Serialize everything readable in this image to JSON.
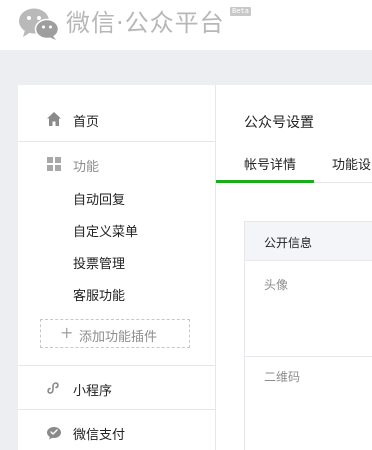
{
  "header": {
    "brand": "微信·公众平台",
    "beta_badge": "Beta"
  },
  "sidebar": {
    "home": "首页",
    "features": {
      "label": "功能",
      "items": [
        "自动回复",
        "自定义菜单",
        "投票管理",
        "客服功能"
      ]
    },
    "add_plugin": "添加功能插件",
    "mini_program": "小程序",
    "wechat_pay": "微信支付"
  },
  "main": {
    "page_title": "公众号设置",
    "tabs": [
      "帐号详情",
      "功能设"
    ],
    "active_tab": "帐号详情",
    "section_header": "公开信息",
    "rows": [
      "头像",
      "二维码"
    ]
  },
  "colors": {
    "accent": "#1aad19",
    "page_background": "#eceef2"
  }
}
